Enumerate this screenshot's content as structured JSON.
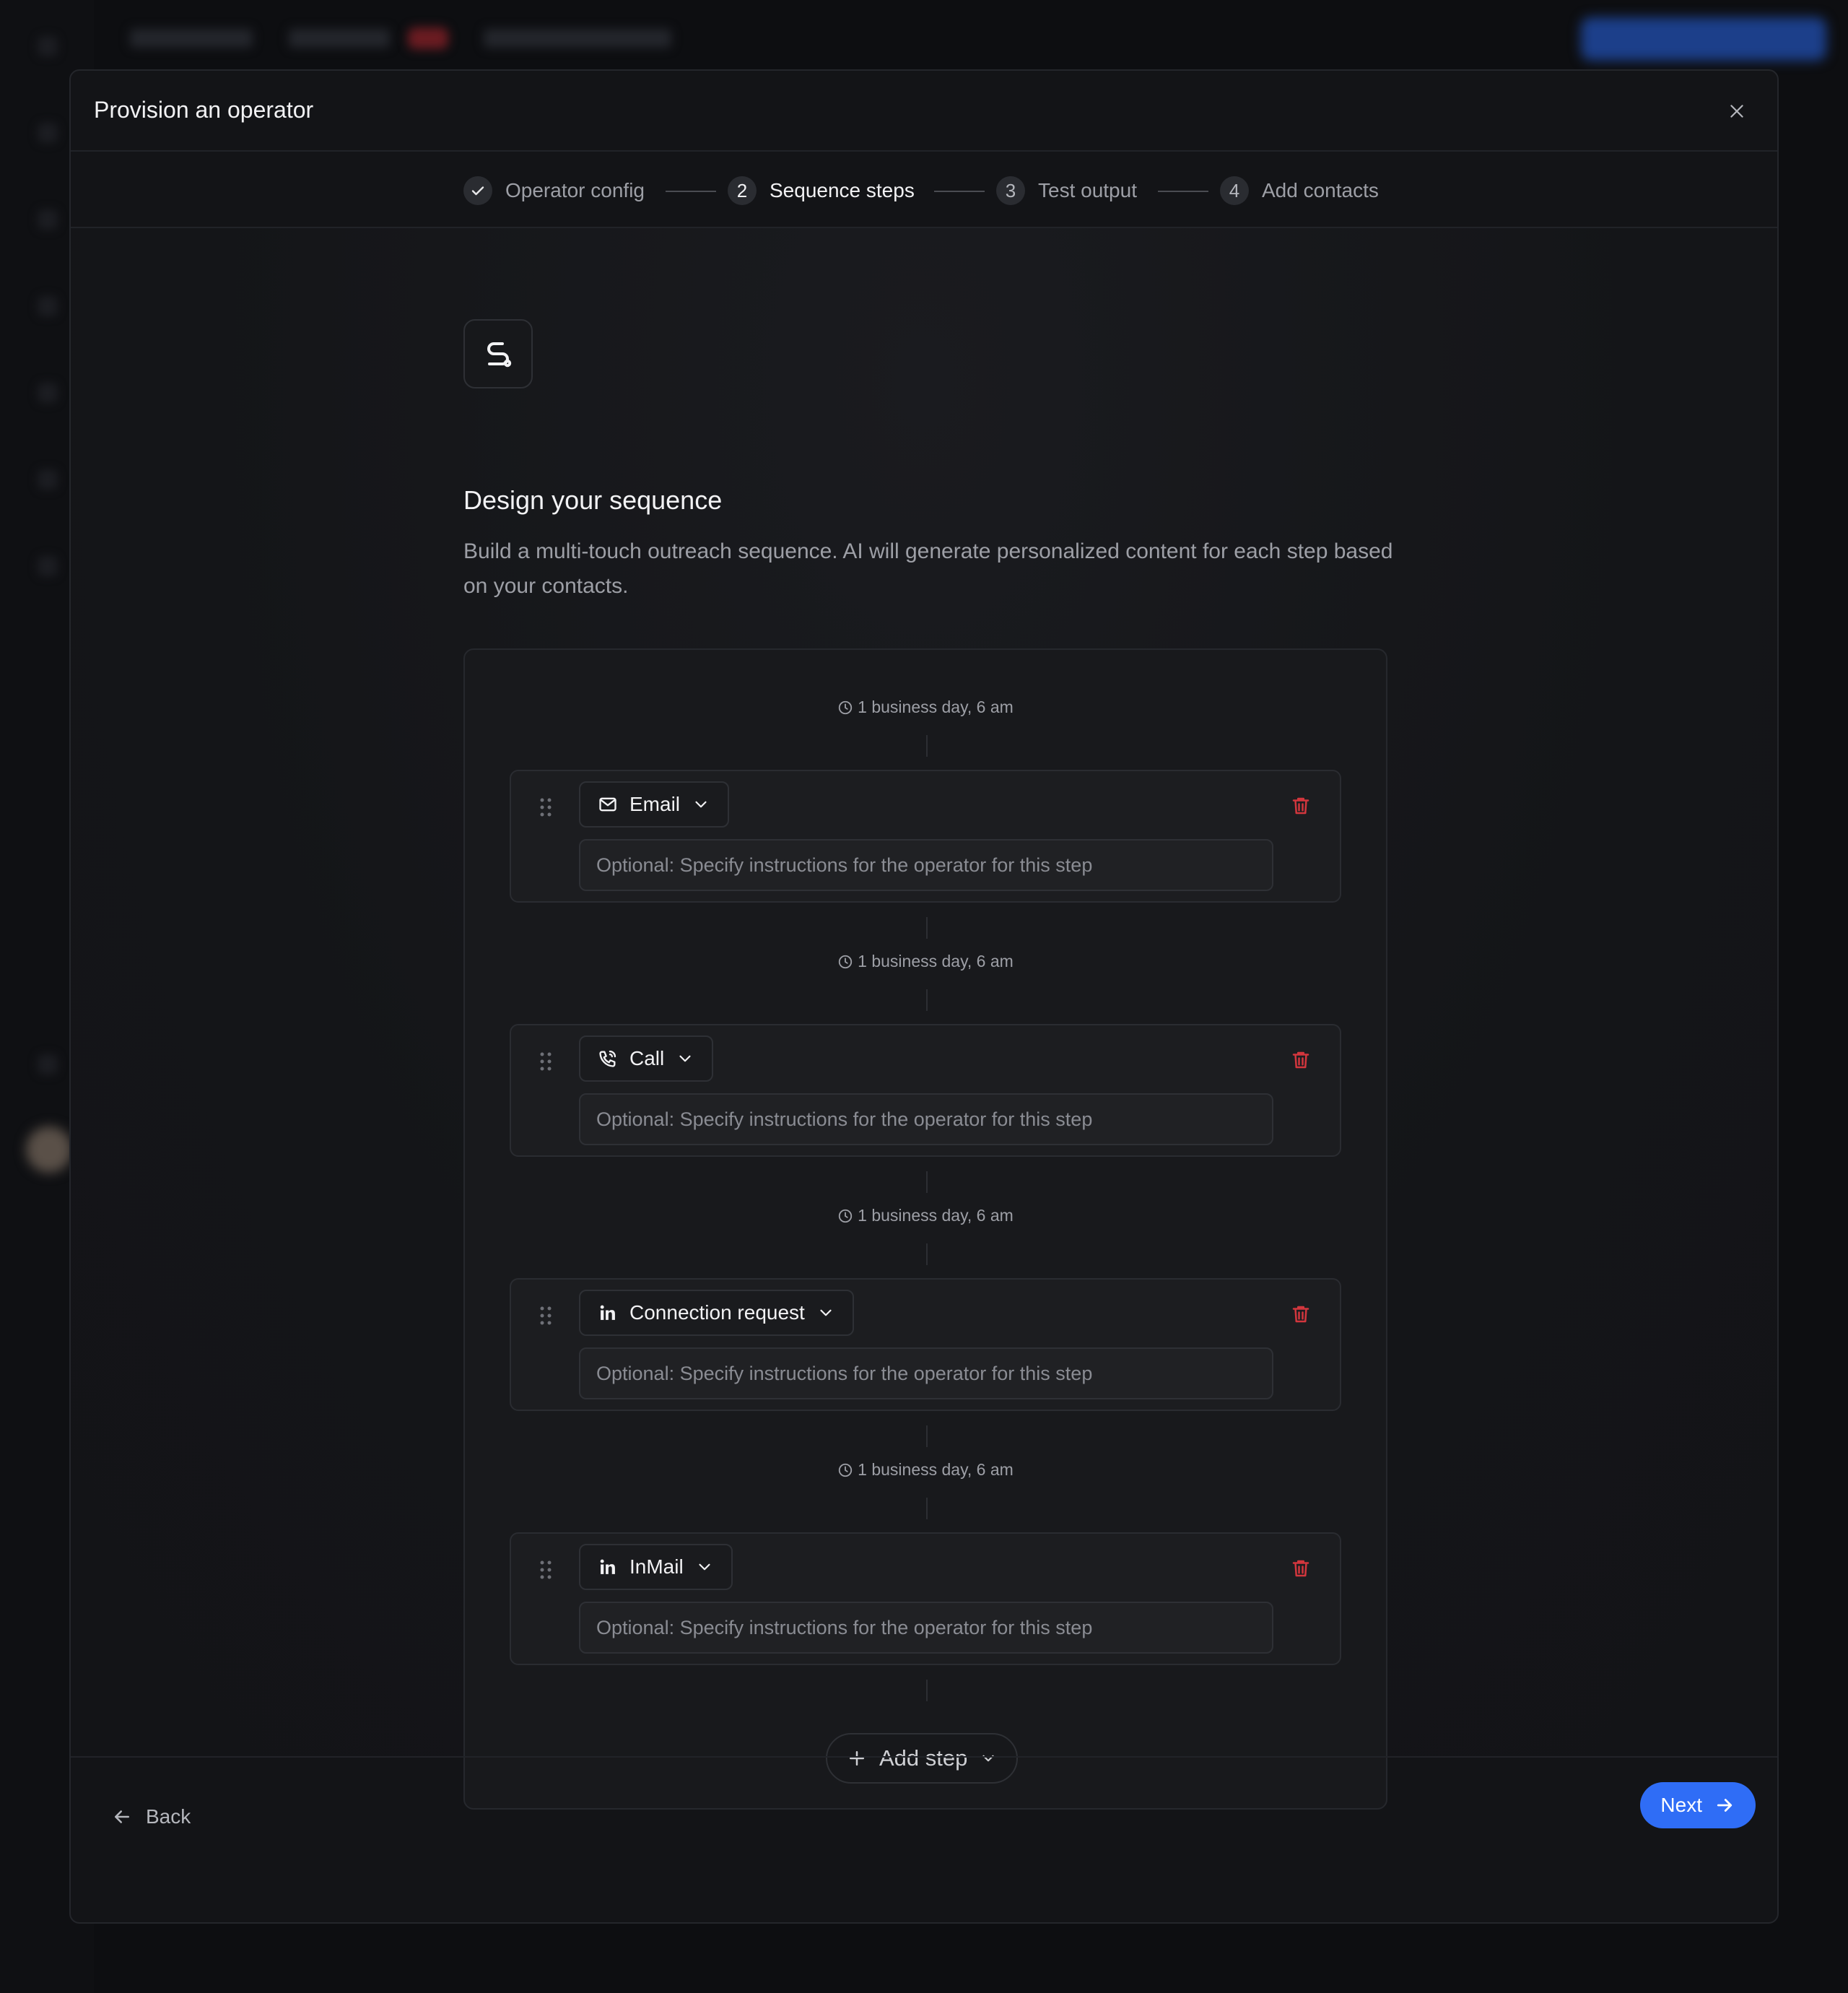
{
  "modal": {
    "title": "Provision an operator"
  },
  "stepper": [
    {
      "number": "",
      "label": "Operator config",
      "state": "done"
    },
    {
      "number": "2",
      "label": "Sequence steps",
      "state": "active"
    },
    {
      "number": "3",
      "label": "Test output",
      "state": "pending"
    },
    {
      "number": "4",
      "label": "Add contacts",
      "state": "pending"
    }
  ],
  "content": {
    "icon": "route-icon",
    "title": "Design your sequence",
    "description": "Build a multi-touch outreach sequence. AI will generate personalized content for each step based on your contacts."
  },
  "sequence": {
    "steps": [
      {
        "delay": "1 business day, 6 am",
        "type": "Email",
        "icon": "mail-icon",
        "placeholder": "Optional: Specify instructions for the operator for this step"
      },
      {
        "delay": "1 business day, 6 am",
        "type": "Call",
        "icon": "phone-icon",
        "placeholder": "Optional: Specify instructions for the operator for this step"
      },
      {
        "delay": "1 business day, 6 am",
        "type": "Connection request",
        "icon": "linkedin-icon",
        "placeholder": "Optional: Specify instructions for the operator for this step"
      },
      {
        "delay": "1 business day, 6 am",
        "type": "InMail",
        "icon": "linkedin-icon",
        "placeholder": "Optional: Specify instructions for the operator for this step"
      }
    ],
    "add_step_label": "Add step"
  },
  "footer": {
    "back_label": "Back",
    "next_label": "Next"
  },
  "colors": {
    "accent": "#2f6df6",
    "danger": "#d2363d",
    "background": "#131417"
  }
}
